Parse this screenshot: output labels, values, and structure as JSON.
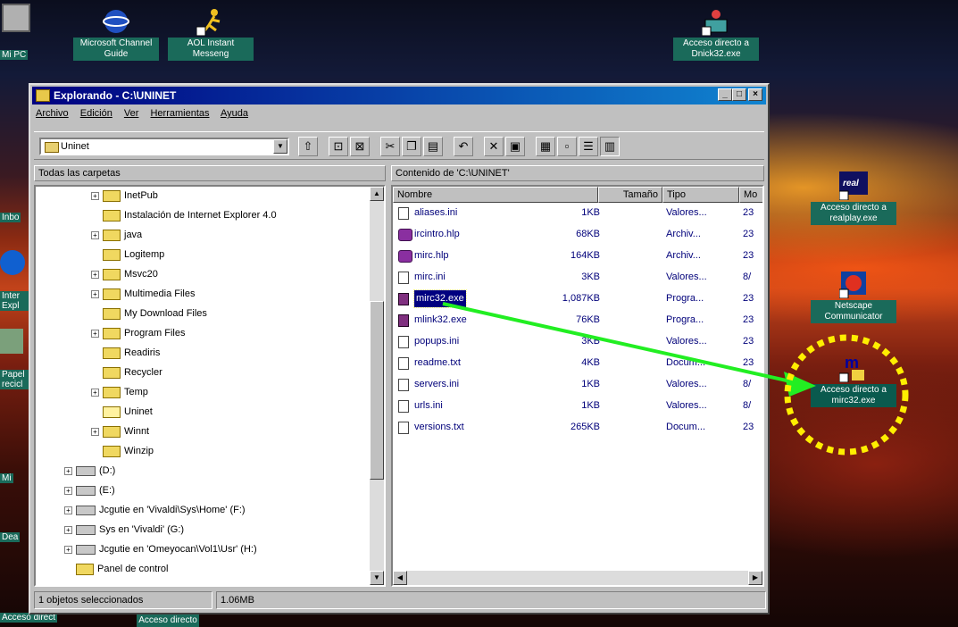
{
  "desktop": {
    "icons": [
      {
        "id": "mipc",
        "label": "Mi PC",
        "x": 2,
        "y": 6,
        "icon": "computer-icon"
      },
      {
        "id": "channel",
        "label": "Microsoft Channel Guide",
        "icon": "satellite-icon"
      },
      {
        "id": "aol",
        "label": "AOL Instant Messeng",
        "icon": "running-man-icon"
      },
      {
        "id": "dnick",
        "label": "Acceso directo a Dnick32.exe",
        "icon": "network-icon"
      },
      {
        "id": "realplay",
        "label": "Acceso directo a realplay.exe",
        "icon": "real-player-icon"
      },
      {
        "id": "netscape",
        "label": "Netscape Communicator",
        "icon": "netscape-icon"
      },
      {
        "id": "mirc",
        "label": "Acceso directo a mirc32.exe",
        "icon": "mirc-icon"
      },
      {
        "id": "bottom",
        "label": "Acceso directo",
        "icon": "shortcut-icon"
      }
    ],
    "left_edge_labels": [
      "Mi PC",
      "Inbo",
      "Inter Expl",
      "Papel recicl",
      "Mi",
      "Dea",
      "Acceso direct"
    ]
  },
  "window": {
    "title": "Explorando - C:\\UNINET",
    "controls": {
      "minimize": "_",
      "maximize": "□",
      "close": "×"
    },
    "menu": [
      "Archivo",
      "Edición",
      "Ver",
      "Herramientas",
      "Ayuda"
    ],
    "address": "Uninet",
    "toolbar_icons": [
      "up-folder-icon",
      "map-drive-icon",
      "disconnect-icon",
      "cut-icon",
      "copy-icon",
      "paste-icon",
      "undo-icon",
      "delete-icon",
      "properties-icon",
      "large-icons-icon",
      "small-icons-icon",
      "list-icon",
      "details-icon"
    ],
    "left_header": "Todas las carpetas",
    "right_header": "Contenido de 'C:\\UNINET'",
    "tree": [
      {
        "label": "InetPub",
        "plus": true,
        "level": 2,
        "type": "folder"
      },
      {
        "label": "Instalación de Internet Explorer 4.0",
        "plus": false,
        "level": 2,
        "type": "folder"
      },
      {
        "label": "java",
        "plus": true,
        "level": 2,
        "type": "folder"
      },
      {
        "label": "Logitemp",
        "plus": false,
        "level": 2,
        "type": "folder"
      },
      {
        "label": "Msvc20",
        "plus": true,
        "level": 2,
        "type": "folder"
      },
      {
        "label": "Multimedia Files",
        "plus": true,
        "level": 2,
        "type": "folder"
      },
      {
        "label": "My Download Files",
        "plus": false,
        "level": 2,
        "type": "folder"
      },
      {
        "label": "Program Files",
        "plus": true,
        "level": 2,
        "type": "folder"
      },
      {
        "label": "Readiris",
        "plus": false,
        "level": 2,
        "type": "folder"
      },
      {
        "label": "Recycler",
        "plus": false,
        "level": 2,
        "type": "folder"
      },
      {
        "label": "Temp",
        "plus": true,
        "level": 2,
        "type": "folder"
      },
      {
        "label": "Uninet",
        "plus": false,
        "level": 2,
        "type": "folder-open"
      },
      {
        "label": "Winnt",
        "plus": true,
        "level": 2,
        "type": "folder"
      },
      {
        "label": "Winzip",
        "plus": false,
        "level": 2,
        "type": "folder"
      },
      {
        "label": "(D:)",
        "plus": true,
        "level": 1,
        "type": "drive"
      },
      {
        "label": "(E:)",
        "plus": true,
        "level": 1,
        "type": "drive"
      },
      {
        "label": "Jcgutie en 'Vivaldi\\Sys\\Home' (F:)",
        "plus": true,
        "level": 1,
        "type": "drive"
      },
      {
        "label": "Sys en 'Vivaldi' (G:)",
        "plus": true,
        "level": 1,
        "type": "drive"
      },
      {
        "label": "Jcgutie en 'Omeyocan\\Vol1\\Usr' (H:)",
        "plus": true,
        "level": 1,
        "type": "drive"
      },
      {
        "label": "Panel de control",
        "plus": false,
        "level": 1,
        "type": "folder"
      }
    ],
    "columns": [
      "Nombre",
      "Tamaño",
      "Tipo",
      "Mo"
    ],
    "files": [
      {
        "name": "aliases.ini",
        "size": "1KB",
        "type": "Valores...",
        "mod": "23",
        "icon": "ini"
      },
      {
        "name": "ircintro.hlp",
        "size": "68KB",
        "type": "Archiv...",
        "mod": "23",
        "icon": "hlp"
      },
      {
        "name": "mirc.hlp",
        "size": "164KB",
        "type": "Archiv...",
        "mod": "23",
        "icon": "hlp"
      },
      {
        "name": "mirc.ini",
        "size": "3KB",
        "type": "Valores...",
        "mod": "8/",
        "icon": "ini"
      },
      {
        "name": "mirc32.exe",
        "size": "1,087KB",
        "type": "Progra...",
        "mod": "23",
        "icon": "exe",
        "selected": true
      },
      {
        "name": "mlink32.exe",
        "size": "76KB",
        "type": "Progra...",
        "mod": "23",
        "icon": "exe"
      },
      {
        "name": "popups.ini",
        "size": "3KB",
        "type": "Valores...",
        "mod": "23",
        "icon": "ini"
      },
      {
        "name": "readme.txt",
        "size": "4KB",
        "type": "Docum...",
        "mod": "23",
        "icon": "txt"
      },
      {
        "name": "servers.ini",
        "size": "1KB",
        "type": "Valores...",
        "mod": "8/",
        "icon": "ini"
      },
      {
        "name": "urls.ini",
        "size": "1KB",
        "type": "Valores...",
        "mod": "8/",
        "icon": "ini"
      },
      {
        "name": "versions.txt",
        "size": "265KB",
        "type": "Docum...",
        "mod": "23",
        "icon": "txt"
      }
    ],
    "status": {
      "selected": "1 objetos seleccionados",
      "size": "1.06MB"
    }
  },
  "annotation": {
    "arrow_color": "#22ee22",
    "circle_color": "#ffee00"
  }
}
